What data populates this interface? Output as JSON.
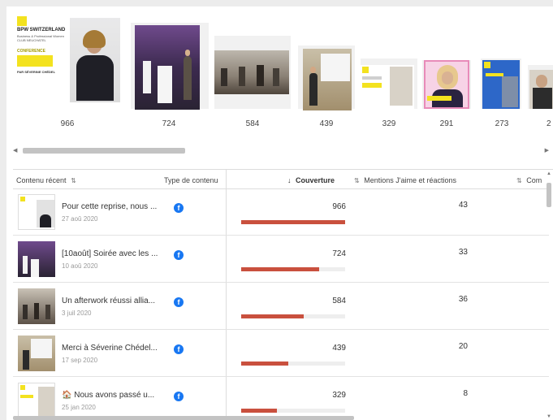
{
  "thumbnails": [
    {
      "count": "966"
    },
    {
      "count": "724"
    },
    {
      "count": "584"
    },
    {
      "count": "439"
    },
    {
      "count": "329"
    },
    {
      "count": "291"
    },
    {
      "count": "273"
    },
    {
      "count": "2"
    }
  ],
  "bpw_card": {
    "logo": "BPW SWITZERLAND",
    "sub": "Business & Professional Women",
    "club": "CLUB NEUCHATEL",
    "headline": "CONFERENCE",
    "speaker": "PAR SÉVERINE CHÉDEL"
  },
  "table": {
    "headers": {
      "content": "Contenu récent",
      "type": "Type de contenu",
      "coverage": "Couverture",
      "likes": "Mentions J'aime et réactions",
      "comments": "Com"
    },
    "sort_icon": "⇅",
    "sort_down_icon": "↓",
    "rows": [
      {
        "title": "Pour cette reprise, nous ...",
        "date": "27 aoû 2020",
        "coverage": "966",
        "coverage_fraction": 1.0,
        "likes": "43"
      },
      {
        "title": "[10août] Soirée avec les ...",
        "date": "10 aoû 2020",
        "coverage": "724",
        "coverage_fraction": 0.75,
        "likes": "33"
      },
      {
        "title": "Un afterwork réussi allia...",
        "date": "3 juil 2020",
        "coverage": "584",
        "coverage_fraction": 0.6,
        "likes": "36"
      },
      {
        "title": "Merci à Séverine Chédel...",
        "date": "17 sep 2020",
        "coverage": "439",
        "coverage_fraction": 0.45,
        "likes": "20"
      },
      {
        "title": "🏠 Nous avons passé u...",
        "date": "25 jan 2020",
        "coverage": "329",
        "coverage_fraction": 0.34,
        "likes": "8"
      }
    ],
    "type_icon": "f"
  },
  "colors": {
    "bar": "#c9503e",
    "facebook": "#1877f2",
    "bpw_yellow": "#f3e21f"
  }
}
